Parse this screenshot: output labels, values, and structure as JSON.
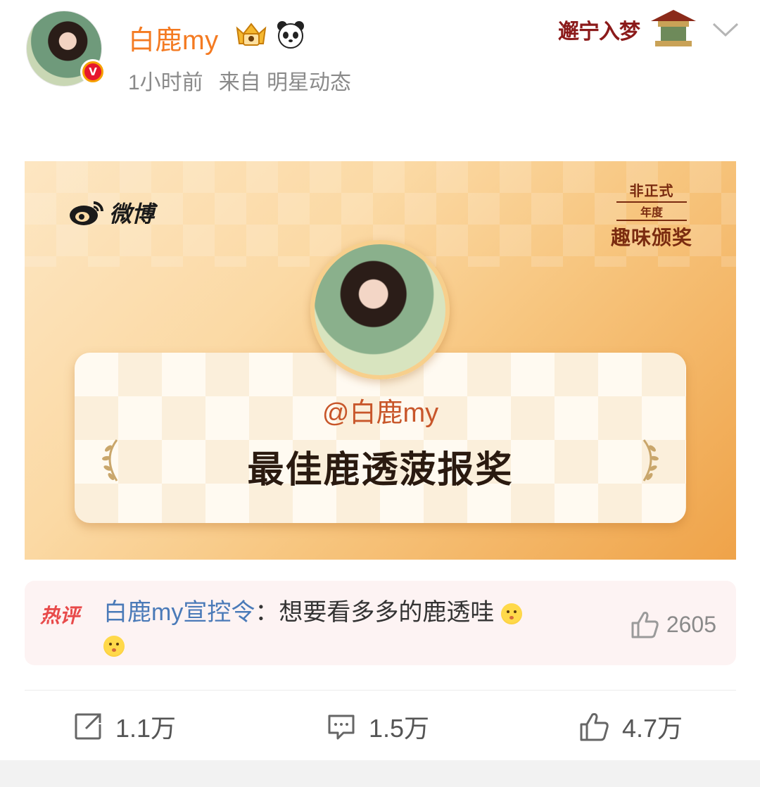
{
  "post": {
    "username": "白鹿my",
    "time": "1小时前",
    "source": "来自 明星动态",
    "verified_glyph": "V",
    "corner_deco_text": "邂宁入梦"
  },
  "card": {
    "logo_text": "微博",
    "award_title_line1": "非正式",
    "award_title_line2": "年度",
    "award_title_line3": "趣味颁奖",
    "handle": "@白鹿my",
    "award_name": "最佳鹿透菠报奖"
  },
  "hot_comment": {
    "tag": "热评",
    "author": "白鹿my宣控令",
    "text": "：想要看多多的鹿透哇",
    "likes": "2605"
  },
  "actions": {
    "reposts": "1.1万",
    "comments": "1.5万",
    "likes": "4.7万"
  },
  "colors": {
    "username": "#f47a21",
    "meta": "#8a8a8a",
    "hot_tag": "#e84a4a",
    "comment_author": "#4a7ab8"
  },
  "icons": [
    "verified-badge-icon",
    "crown-badge-icon",
    "panda-badge-icon",
    "chevron-down-icon",
    "weibo-logo-icon",
    "laurel-icon",
    "like-icon",
    "share-icon",
    "comment-icon",
    "emoji-icon"
  ]
}
